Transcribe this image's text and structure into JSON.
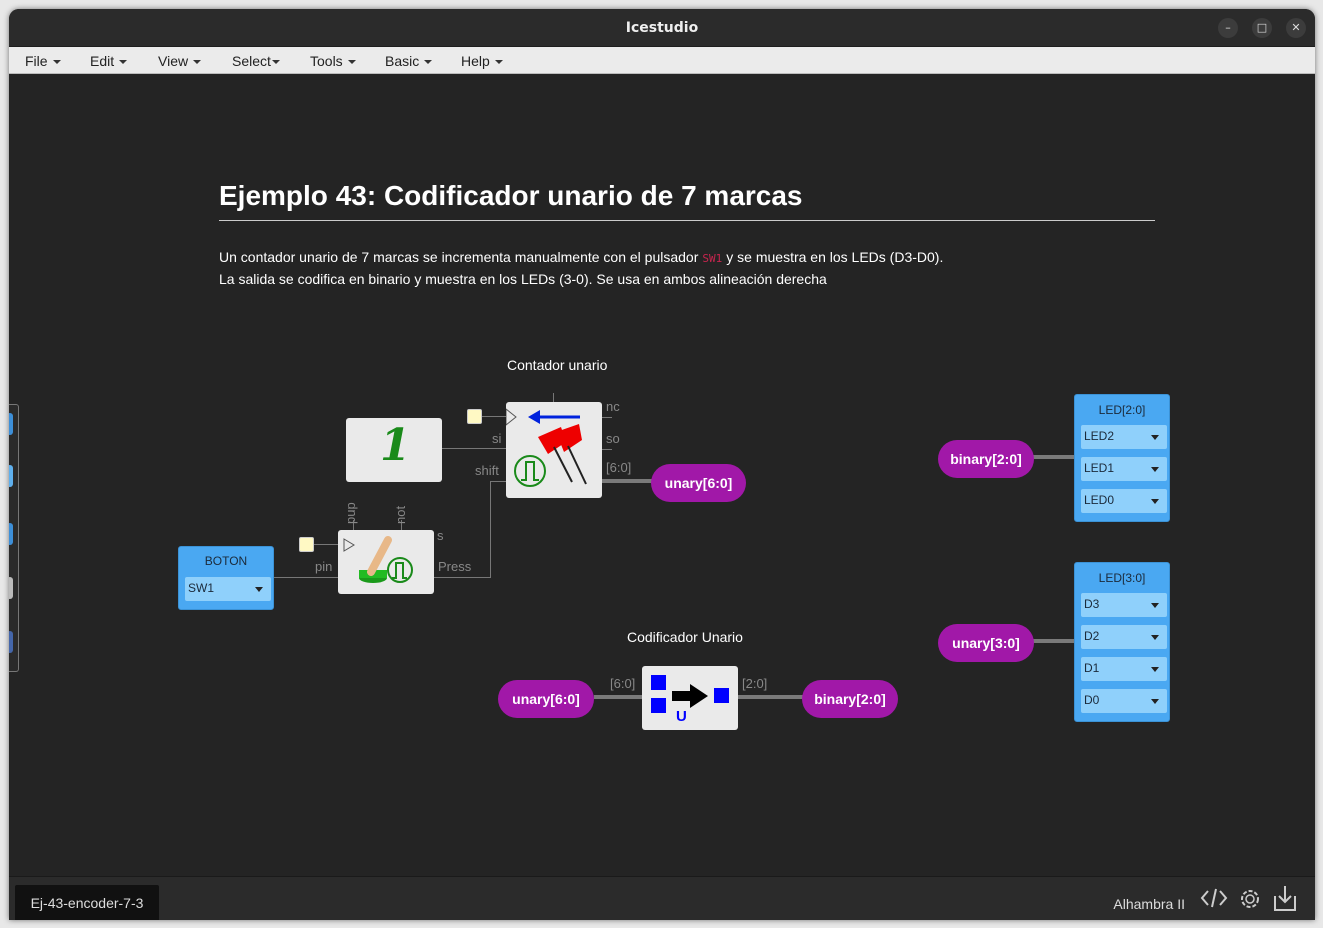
{
  "window": {
    "title": "Icestudio"
  },
  "menu": [
    {
      "label": "File"
    },
    {
      "label": "Edit"
    },
    {
      "label": "View"
    },
    {
      "label": "Select"
    },
    {
      "label": "Tools"
    },
    {
      "label": "Basic"
    },
    {
      "label": "Help"
    }
  ],
  "doc": {
    "heading": "Ejemplo 43: Codificador unario de 7 marcas",
    "line1_before": "Un contador unario de 7 marcas se incrementa manualmente con el pulsador",
    "line1_code": "SW1",
    "line1_after": "y se muestra en los LEDs (D3-D0).",
    "line2": "La salida se codifica en binario y muestra en los LEDs (3-0). Se usa en ambos alineación derecha"
  },
  "circuit": {
    "contador_label": "Contador unario",
    "codificador_label": "Codificador Unario",
    "pins": {
      "nc": "nc",
      "si": "si",
      "so": "so",
      "shift": "shift",
      "bus6": "[6:0]",
      "bus2": "[2:0]",
      "pin": "pin",
      "press": "Press",
      "s": "s",
      "pup": "pup",
      "not": "not"
    },
    "constant_value": "1",
    "boton": {
      "title": "BOTON",
      "value": "SW1"
    },
    "led20": {
      "title": "LED[2:0]",
      "items": [
        "LED2",
        "LED1",
        "LED0"
      ]
    },
    "led30": {
      "title": "LED[3:0]",
      "items": [
        "D3",
        "D2",
        "D1",
        "D0"
      ]
    },
    "labels": {
      "unary_out": "unary[6:0]",
      "binary_in": "binary[2:0]",
      "unary3": "unary[3:0]",
      "unary_in": "unary[6:0]",
      "binary_out": "binary[2:0]"
    }
  },
  "status": {
    "file": "Ej-43-encoder-7-3",
    "board": "Alhambra II"
  },
  "colors": {
    "label_pill": "#a118a8",
    "io_block": "#4aa8f2",
    "canvas": "#242424"
  }
}
